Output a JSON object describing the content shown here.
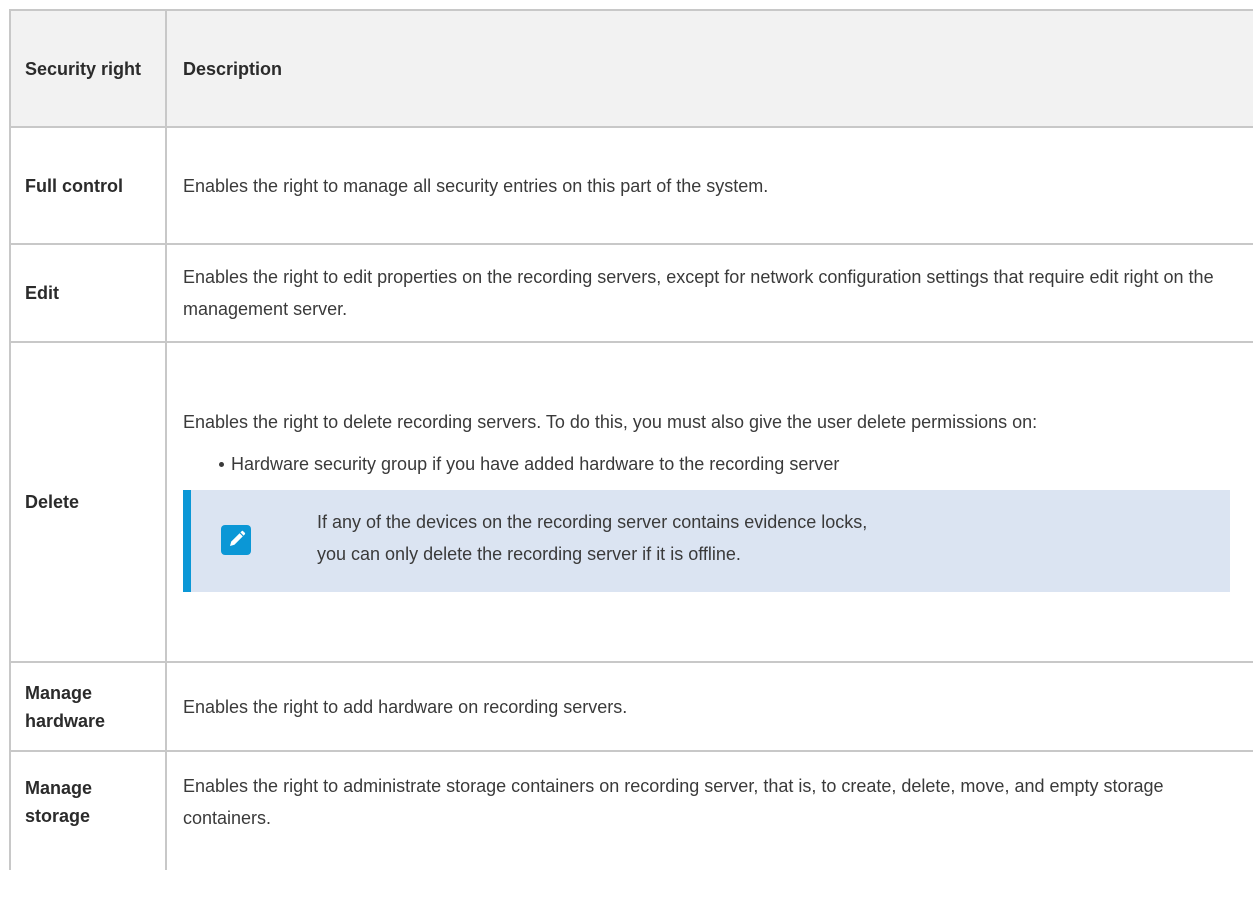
{
  "table": {
    "header": {
      "name": "Security right",
      "description": "Description"
    },
    "rows": {
      "full": {
        "name": "Full control",
        "description": "Enables the right to manage all security entries on this part of the system."
      },
      "edit": {
        "name": "Edit",
        "description": "Enables the right to edit properties on the recording servers, except for network configuration settings that require edit right on the management server."
      },
      "delete": {
        "name": "Delete",
        "description": "Enables the right to delete recording servers. To do this, you must also give the user delete permissions on:",
        "bullets": [
          "Hardware security group if you have added hardware to the recording server"
        ],
        "note": {
          "icon": "pencil-icon",
          "line1": "If any of the devices on the recording server contains evidence locks,",
          "line2": "you can only delete the recording server if it is offline."
        }
      },
      "hardware": {
        "name": "Manage hardware",
        "description": "Enables the right to add hardware on recording servers."
      },
      "storage": {
        "name": "Manage storage",
        "description": "Enables the right to administrate storage containers on recording server, that is, to create, delete, move, and empty storage containers."
      }
    }
  },
  "colors": {
    "accent": "#0b97d6",
    "note_background": "#dbe4f2",
    "header_background": "#f2f2f2",
    "border": "#c8c8c8"
  }
}
